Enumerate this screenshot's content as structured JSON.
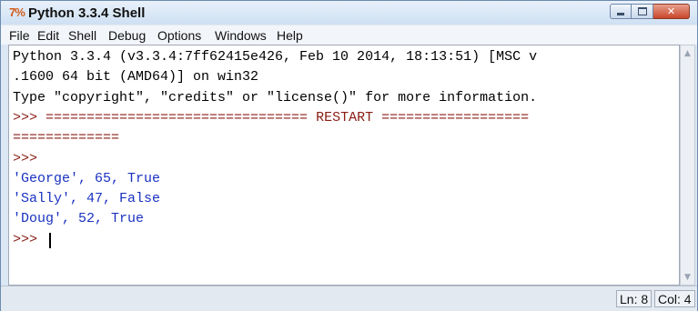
{
  "window": {
    "title": "Python 3.3.4 Shell",
    "icon_glyph": "7%"
  },
  "menu": {
    "items": [
      "File",
      "Edit",
      "Shell",
      "Debug",
      "Options",
      "Windows",
      "Help"
    ]
  },
  "shell": {
    "lines": [
      {
        "text": "Python 3.3.4 (v3.3.4:7ff62415e426, Feb 10 2014, 18:13:51) [MSC v",
        "style": "normal"
      },
      {
        "text": ".1600 64 bit (AMD64)] on win32",
        "style": "normal"
      },
      {
        "text": "Type \"copyright\", \"credits\" or \"license()\" for more information.",
        "style": "normal"
      },
      {
        "prompt": ">>> ",
        "text": "================================ RESTART ==================",
        "style": "restart"
      },
      {
        "text": "=============",
        "style": "normal"
      },
      {
        "prompt": ">>>",
        "text": "",
        "style": "prompt"
      },
      {
        "text": "'George', 65, True",
        "style": "output"
      },
      {
        "text": "'Sally', 47, False",
        "style": "output"
      },
      {
        "text": "'Doug', 52, True",
        "style": "output"
      },
      {
        "prompt": ">>> ",
        "text": "",
        "style": "prompt"
      }
    ]
  },
  "status": {
    "line": "Ln: 8",
    "col": "Col: 4"
  },
  "colors": {
    "prompt": "#8a1c14",
    "output": "#1a32c0"
  }
}
